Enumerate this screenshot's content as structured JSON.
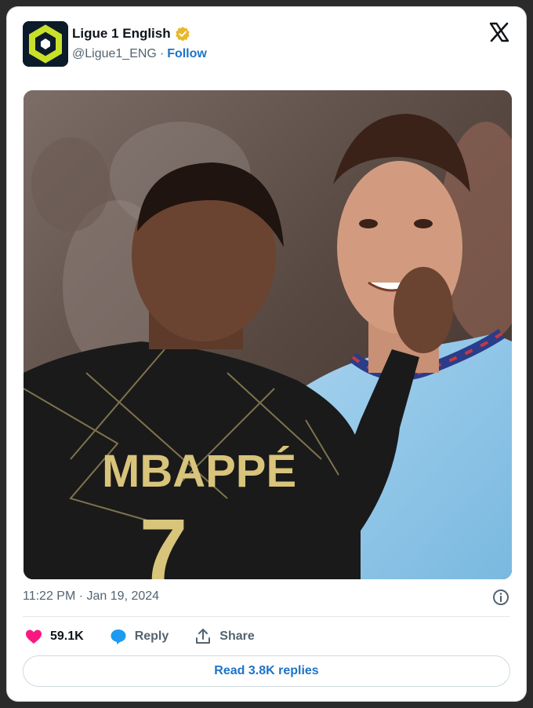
{
  "account": {
    "name": "Ligue 1 English",
    "handle": "@Ligue1_ENG",
    "separator": "·",
    "follow_label": "Follow"
  },
  "media": {
    "jersey_name": "MBAPPÉ",
    "jersey_number": "7"
  },
  "timestamp": "11:22 PM · Jan 19, 2024",
  "actions": {
    "likes": "59.1K",
    "reply_label": "Reply",
    "share_label": "Share"
  },
  "read_replies_label": "Read 3.8K replies",
  "colors": {
    "accent": "#1d73c8",
    "like": "#f91880",
    "verified": "#e8b82c",
    "logo_bg": "#0c1b2a",
    "logo_mark": "#c8e02a"
  },
  "icons": [
    "ligue1-logo-icon",
    "verified-badge-icon",
    "x-logo-icon",
    "info-icon",
    "heart-icon",
    "reply-bubble-icon",
    "share-icon"
  ]
}
